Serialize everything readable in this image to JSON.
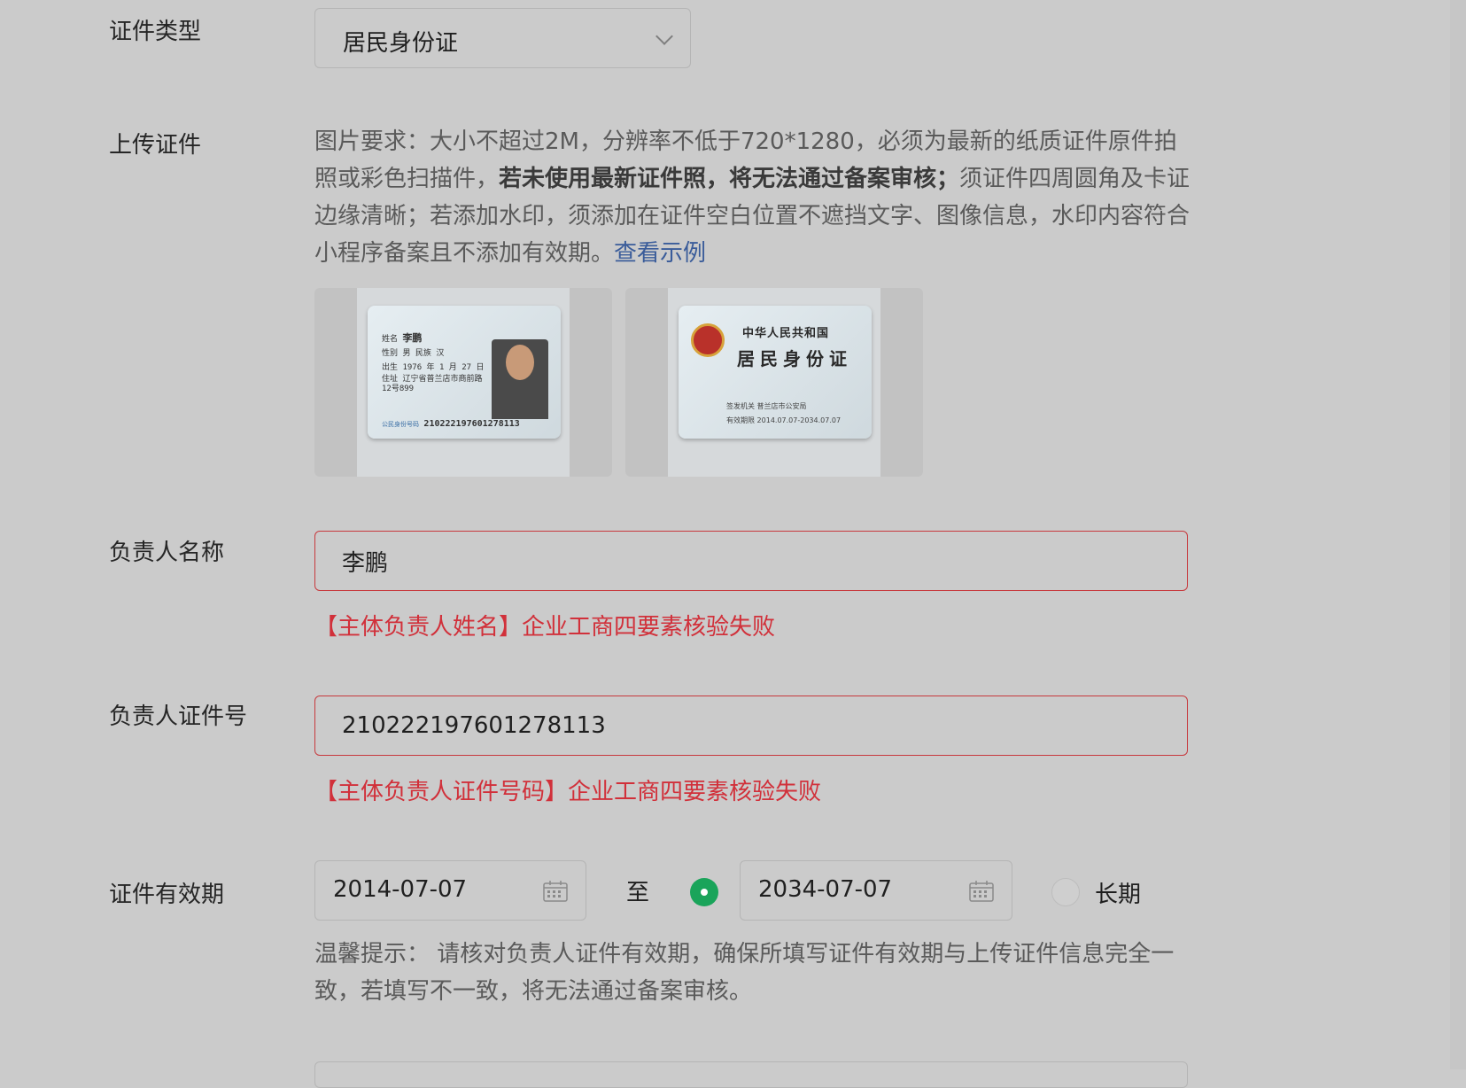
{
  "labels": {
    "id_type": "证件类型",
    "upload": "上传证件",
    "person_name": "负责人名称",
    "person_id": "负责人证件号",
    "validity": "证件有效期"
  },
  "id_type_select": {
    "value": "居民身份证"
  },
  "upload": {
    "req_prefix": "图片要求：大小不超过2M，分辨率不低于720*1280，必须为最新的纸质证件原件拍照或彩色扫描件，",
    "req_bold": "若未使用最新证件照，将无法通过备案审核；",
    "req_suffix": "须证件四周圆角及卡证边缘清晰；若添加水印，须添加在证件空白位置不遮挡文字、图像信息，水印内容符合小程序备案且不添加有效期。",
    "example_link": "查看示例",
    "front_card": {
      "name_label": "姓名",
      "name": "李鹏",
      "sex_label": "性别",
      "sex": "男",
      "ethnic_label": "民族",
      "ethnic": "汉",
      "birth_label": "出生",
      "birth": "1976 年 1 月 27 日",
      "addr_label": "住址",
      "addr": "辽宁省普兰店市商前路12号899",
      "id_label": "公民身份号码",
      "id_number": "210222197601278113"
    },
    "back_card": {
      "country": "中华人民共和国",
      "title": "居民身份证",
      "authority_label": "签发机关",
      "authority": "普兰店市公安局",
      "validity_label": "有效期限",
      "validity": "2014.07.07-2034.07.07"
    }
  },
  "person_name": {
    "value": "李鹏",
    "error": "【主体负责人姓名】企业工商四要素核验失败"
  },
  "person_id": {
    "value": "210222197601278113",
    "error": "【主体负责人证件号码】企业工商四要素核验失败"
  },
  "validity": {
    "start": "2014-07-07",
    "to_label": "至",
    "end": "2034-07-07",
    "long_term_label": "长期",
    "hint": "温馨提示： 请核对负责人证件有效期，确保所填写证件有效期与上传证件信息完全一致，若填写不一致，将无法通过备案审核。"
  },
  "icons": {
    "select_arrow": "chevron-down-icon",
    "calendar": "calendar-icon",
    "emblem": "national-emblem-icon"
  },
  "colors": {
    "error": "#d1303a",
    "radio_selected": "#1aa45a",
    "link": "#3a5c9a"
  }
}
